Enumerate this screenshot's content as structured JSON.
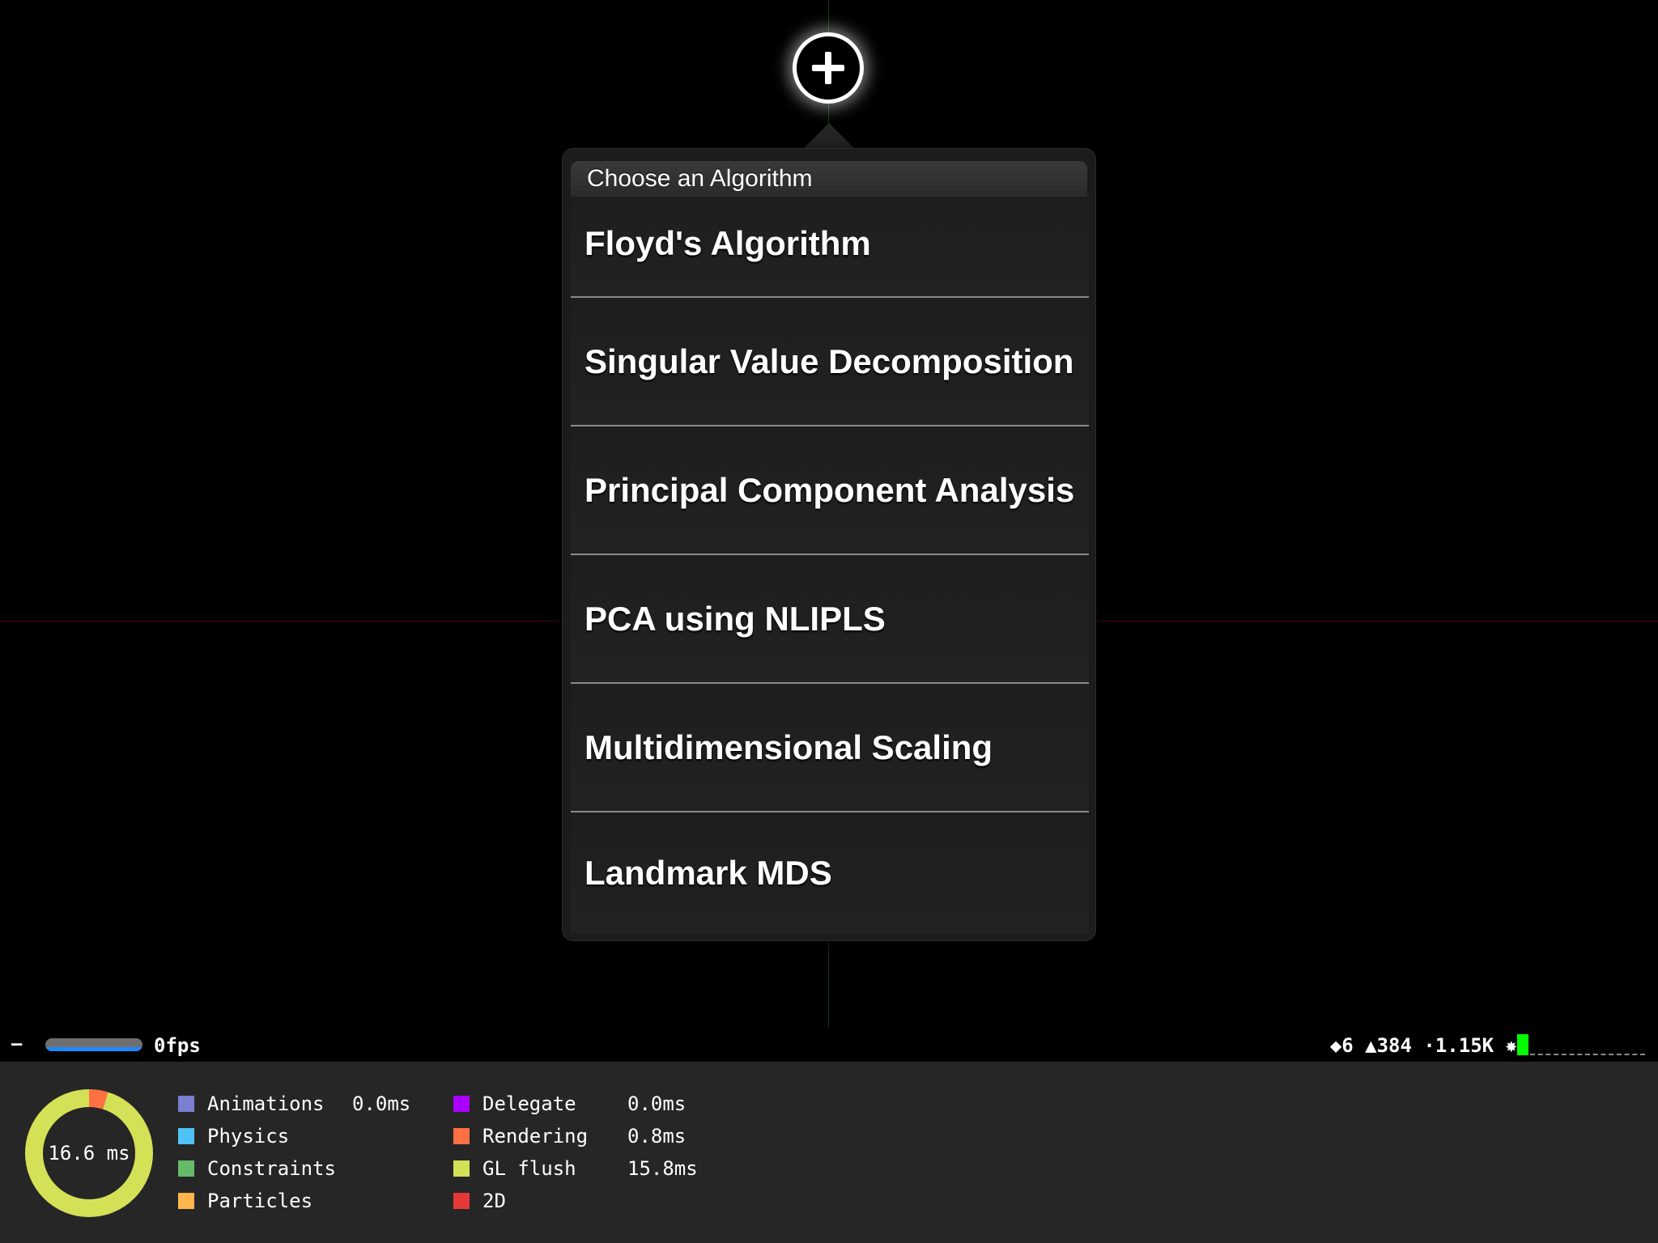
{
  "add_button": {
    "icon": "plus-icon"
  },
  "popover": {
    "title": "Choose an Algorithm",
    "items": [
      {
        "label": "Floyd's Algorithm"
      },
      {
        "label": "Singular Value Decomposition"
      },
      {
        "label": "Principal Component Analysis"
      },
      {
        "label": "PCA using NLIPLS"
      },
      {
        "label": "Multidimensional Scaling"
      },
      {
        "label": "Landmark MDS"
      }
    ]
  },
  "stats_bar": {
    "collapse": "–",
    "fps": "0fps",
    "node_stats": "◆6 ▲384 ·1.15K ✸"
  },
  "perf": {
    "total": "16.6 ms",
    "legend_left": [
      {
        "name": "Animations",
        "value": "0.0ms",
        "color": "#7a7fd1"
      },
      {
        "name": "Physics",
        "value": "",
        "color": "#4fc3f7"
      },
      {
        "name": "Constraints",
        "value": "",
        "color": "#66bb6a"
      },
      {
        "name": "Particles",
        "value": "",
        "color": "#ffb74d"
      }
    ],
    "legend_right": [
      {
        "name": "Delegate",
        "value": "0.0ms",
        "color": "#aa00ff"
      },
      {
        "name": "Rendering",
        "value": "0.8ms",
        "color": "#ff7043"
      },
      {
        "name": "GL flush",
        "value": "15.8ms",
        "color": "#d4e157"
      },
      {
        "name": "2D",
        "value": "",
        "color": "#e53935"
      }
    ],
    "ring_segments": [
      {
        "label": "Rendering",
        "value": 0.8,
        "color": "#ff7043"
      },
      {
        "label": "GL flush",
        "value": 15.8,
        "color": "#d4e157"
      }
    ]
  }
}
